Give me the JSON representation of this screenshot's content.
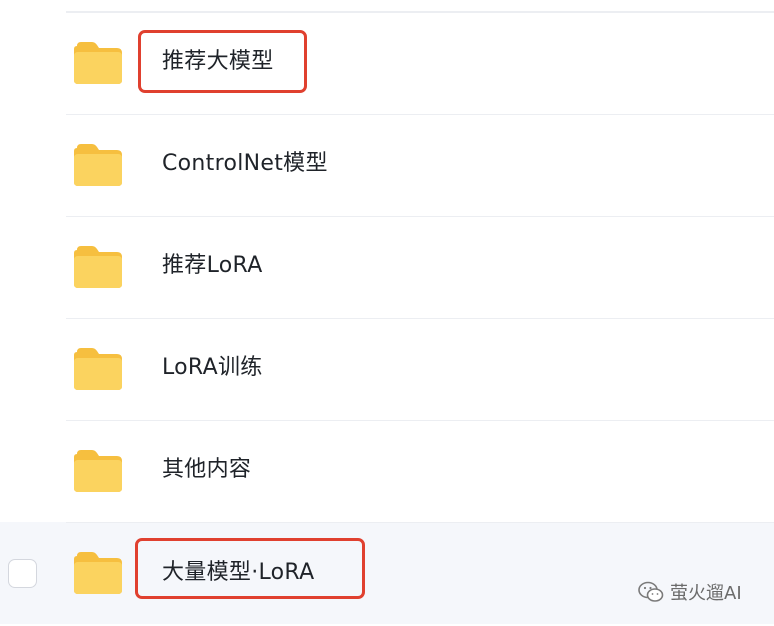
{
  "files": [
    {
      "name": "推荐大模型",
      "type": "folder-icon",
      "highlighted": true
    },
    {
      "name": "ControlNet模型",
      "type": "folder-icon",
      "highlighted": false
    },
    {
      "name": "推荐LoRA",
      "type": "folder-icon",
      "highlighted": false
    },
    {
      "name": "LoRA训练",
      "type": "folder-icon",
      "highlighted": false
    },
    {
      "name": "其他内容",
      "type": "folder-icon",
      "highlighted": false
    },
    {
      "name": "大量模型·LoRA",
      "type": "folder-icon",
      "highlighted": true,
      "hovered": true
    }
  ],
  "watermark": {
    "text": "萤火遛AI",
    "icon": "wechat-icon"
  },
  "colors": {
    "highlight": "#e0402f",
    "folder": "#f9ce5b",
    "hover_row": "#f5f7fb"
  }
}
